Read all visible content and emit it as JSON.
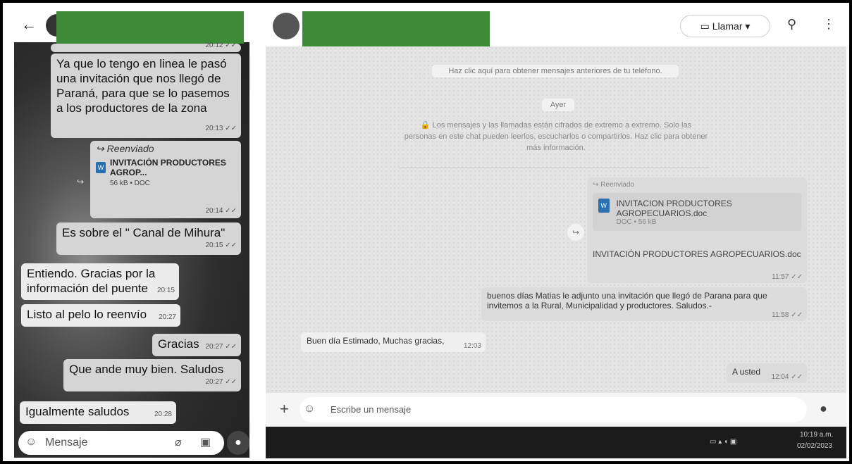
{
  "phone": {
    "back": "←",
    "messages": [
      {
        "text": "Ya que lo tengo en linea le pasó una invitación que nos llegó de Paraná, para que se lo pasemos a los productores de la zona",
        "time": "20:13 ✓✓",
        "partial_time": "20:12 ✓✓"
      },
      {
        "forwarded": "Reenviado",
        "doc_title": "INVITACIÓN PRODUCTORES AGROP...",
        "doc_meta": "56 kB • DOC",
        "time": "20:14 ✓✓"
      },
      {
        "text": "Es sobre el \" Canal de Mihura\"",
        "time": "20:15 ✓✓"
      },
      {
        "text": "Entiendo. Gracias por la información del puente",
        "time": "20:15"
      },
      {
        "text": "Listo al pelo lo reenvío",
        "time": "20:27"
      },
      {
        "text": "Gracias",
        "time": "20:27 ✓✓"
      },
      {
        "text": "Que ande muy bien. Saludos",
        "time": "20:27 ✓✓"
      },
      {
        "text": "Igualmente saludos",
        "time": "20:28"
      }
    ],
    "input_placeholder": "Mensaje",
    "doc_icon": "W"
  },
  "desktop": {
    "call_label": "Llamar",
    "system_note": "Haz clic aquí para obtener mensajes anteriores de tu teléfono.",
    "day_label": "Ayer",
    "encryption_note": "🔒 Los mensajes y las llamadas están cifrados de extremo a extremo. Solo las personas en este chat pueden leerlos, escucharlos o compartirlos. Haz clic para obtener más información.",
    "forwarded": "Reenviado",
    "doc_title": "INVITACION PRODUCTORES AGROPECUARIOS.doc",
    "doc_meta": "DOC • 56 kB",
    "doc_caption": "INVITACIÓN PRODUCTORES AGROPECUARIOS.doc",
    "doc_time": "11:57 ✓✓",
    "msg_out": "buenos días Matias le adjunto una invitación que llegó de Parana para que invitemos a la Rural, Municipalidad y productores. Saludos.-",
    "msg_out_time": "11:58 ✓✓",
    "msg_in": "Buen día Estimado, Muchas gracias,",
    "msg_in_time": "12:03",
    "msg_out2": "A usted",
    "msg_out2_time": "12:04 ✓✓",
    "input_placeholder": "Escribe un mensaje",
    "doc_icon": "W",
    "taskbar_time": "10:19 a.m.",
    "taskbar_date": "02/02/2023"
  }
}
